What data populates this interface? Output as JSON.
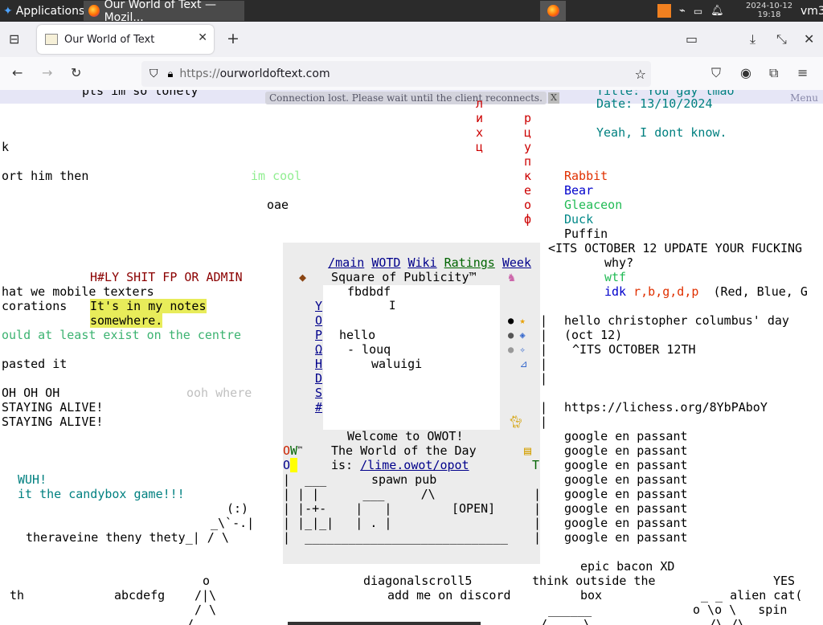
{
  "taskbar": {
    "apps_label": "Applications",
    "window_title": "Our World of Text — Mozil...",
    "clock_date": "2024-10-12",
    "clock_time": "19:18",
    "user": "vm3"
  },
  "browser": {
    "tab_title": "Our World of Text",
    "url_prefix": "https://",
    "url_host": "ourworldoftext.com"
  },
  "banner": {
    "connection": "Connection lost. Please wait until the client reconnects.",
    "close": "X",
    "menu": "Menu"
  },
  "world": {
    "top_left": "pts im so lonely",
    "cyr_col1": [
      "л",
      "и",
      "х",
      "ц"
    ],
    "cyr_col2": [
      "р",
      "ц",
      "у",
      "п",
      "к",
      "е",
      "о",
      "ф"
    ],
    "title_line": "Title: You gay lmao",
    "date_line": "Date: 13/10/2024",
    "yeah": "Yeah, I dont know.",
    "k": "k",
    "ort": "ort him then",
    "im_cool": "im cool",
    "oae": "oae",
    "animals": [
      {
        "name": "Rabbit",
        "color": "#e03000"
      },
      {
        "name": "Bear",
        "color": "#0000cc"
      },
      {
        "name": "Gleaceon",
        "color": "#22bb55"
      },
      {
        "name": "Duck",
        "color": "#008888"
      },
      {
        "name": "Puffin",
        "color": "#000000"
      }
    ],
    "oct_update": "<ITS OCTOBER 12 UPDATE YOUR FUCKING",
    "why": "why?",
    "wtf": "wtf",
    "idk": "idk",
    "idk_letters": "r,b,g,d,p",
    "idk_tail": "(Red, Blue, G",
    "holy": "H#LY SHIT FP OR ADMIN",
    "mobile": "hat we mobile texters",
    "corations": "corations",
    "notes1": "It's in my notes",
    "notes2": "somewhere.",
    "centre": "ould at least exist on the centre",
    "pasted": "pasted it",
    "columbus1": "hello christopher columbus' day",
    "columbus2": "(oct 12)",
    "columbus3": "^ITS OCTOBER 12TH",
    "ohoh": "OH OH OH",
    "ooh_where": "ooh where",
    "staying1": "STAYING ALIVE!",
    "staying2": "STAYING ALIVE!",
    "lichess": "https://lichess.org/8YbPAboY",
    "google": [
      "google en passant",
      "google en passant",
      "google en passant",
      "google en passant",
      "google en passant",
      "google en passant",
      "google en passant",
      "google en passant"
    ],
    "wuh": "WUH!",
    "candybox": "it the candybox game!!!",
    "cat_art": [
      "(:)",
      "_\\`-.|",
      "_| / \\"
    ],
    "theraveine": "theraveine theny thety",
    "epic": "epic bacon XD",
    "think1": "think outside the",
    "think2": "box",
    "yes": "YES",
    "alien": "_ _ alien cat(",
    "alien2": "o \\o \\   spin",
    "alien3": "/\\ /\\",
    "o_fig": [
      "o",
      "/|\\",
      "/ \\"
    ],
    "th": "th",
    "abcdefg": "abcdefg",
    "diagonal": "diagonalscroll5",
    "discord": "add me on discord",
    "spawn_pub": "spawn pub",
    "open": "[OPEN]",
    "underline": "______"
  },
  "panel": {
    "nav": [
      {
        "label": "/main",
        "color": "#00008b"
      },
      {
        "label": "WOTD",
        "color": "#00008b"
      },
      {
        "label": "Wiki",
        "color": "#00008b"
      },
      {
        "label": "Ratings",
        "color": "#006400"
      },
      {
        "label": "Week",
        "color": "#00008b"
      }
    ],
    "title": "Square of Publicity™",
    "side_letters": [
      "Y",
      "O",
      "P",
      "Ω",
      "H",
      "D",
      "S",
      "#"
    ],
    "content": [
      "fbdbdf",
      "",
      "",
      "hello",
      "- louq",
      "waluigi"
    ],
    "welcome": "Welcome to OWOT!",
    "wotd1": "The World of the Day",
    "wotd2_prefix": "is:",
    "wotd2_link": "/lime.owot/opot",
    "ow": "OW",
    "tm": "™",
    "o": "O",
    "t": "T"
  }
}
